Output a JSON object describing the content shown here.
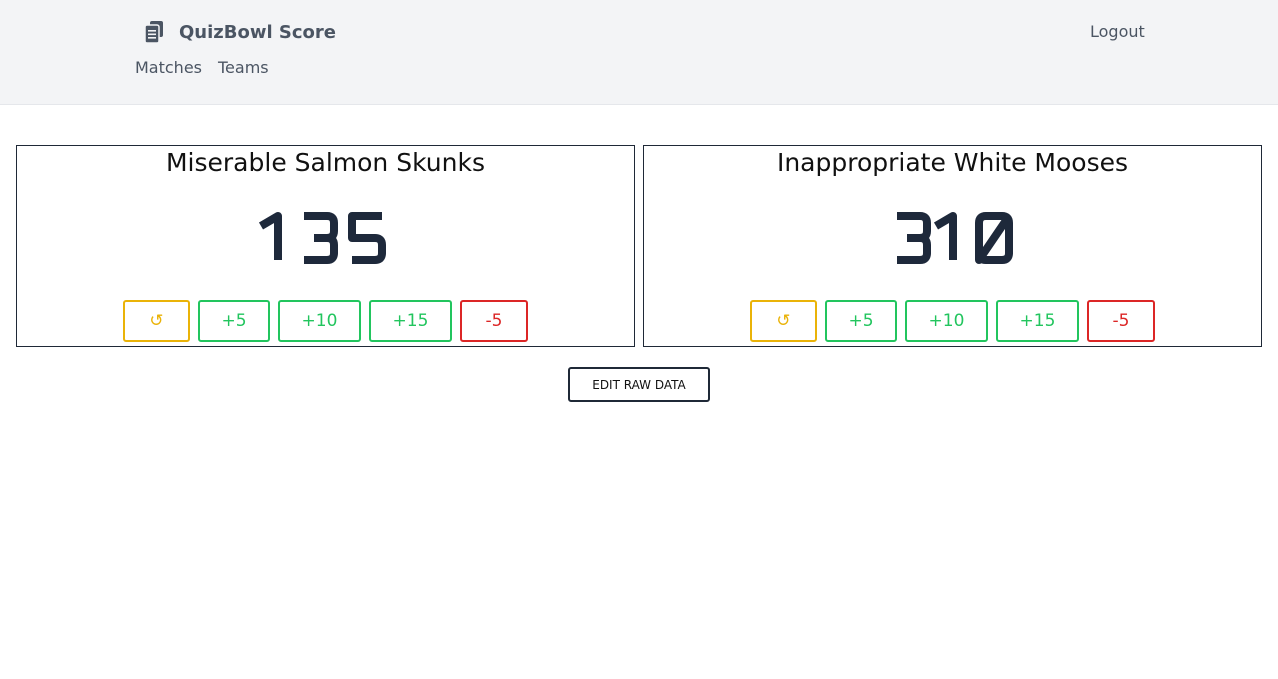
{
  "app": {
    "title": "QuizBowl Score",
    "icon": "clipboard-copy-icon"
  },
  "nav": {
    "logout_label": "Logout",
    "links": [
      "Matches",
      "Teams"
    ]
  },
  "teams": [
    {
      "name": "Miserable Salmon Skunks",
      "score": "135",
      "buttons": {
        "undo": "↺",
        "plus5": "+5",
        "plus10": "+10",
        "plus15": "+15",
        "minus5": "-5"
      }
    },
    {
      "name": "Inappropriate White Mooses",
      "score": "310",
      "buttons": {
        "undo": "↺",
        "plus5": "+5",
        "plus10": "+10",
        "plus15": "+15",
        "minus5": "-5"
      }
    }
  ],
  "actions": {
    "edit_raw_data_label": "EDIT RAW DATA"
  },
  "colors": {
    "undo": "#eab308",
    "plus": "#22c55e",
    "minus": "#dc2626",
    "score": "#1e293b",
    "navbar_bg": "#f3f4f6"
  }
}
